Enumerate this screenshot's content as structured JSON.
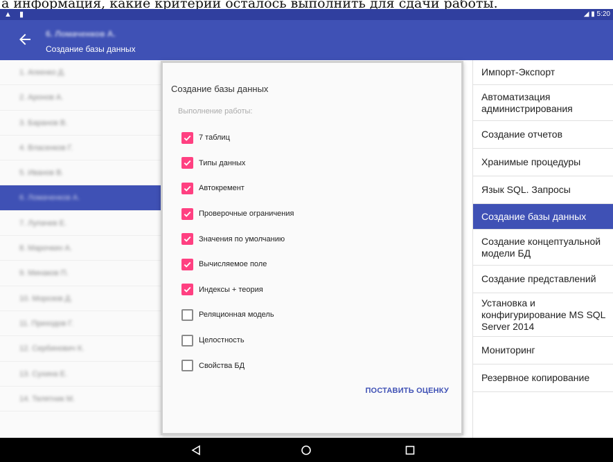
{
  "caption": "а информация, какие критерии осталось выполнить для сдачи работы.",
  "status_bar": {
    "time": "5:20"
  },
  "app_bar": {
    "student": "6. Ломаченков А.",
    "subtitle": "Создание базы данных"
  },
  "students": [
    {
      "label": "1. Агеенко Д.",
      "active": false
    },
    {
      "label": "2. Аронов А.",
      "active": false
    },
    {
      "label": "3. Баранов В.",
      "active": false
    },
    {
      "label": "4. Власенков Г.",
      "active": false
    },
    {
      "label": "5. Иванов В.",
      "active": false
    },
    {
      "label": "6. Ломаченков А.",
      "active": true
    },
    {
      "label": "7. Лупачев Е.",
      "active": false
    },
    {
      "label": "8. Марочкин А.",
      "active": false
    },
    {
      "label": "9. Минаков П.",
      "active": false
    },
    {
      "label": "10. Морозов Д.",
      "active": false
    },
    {
      "label": "11. Приходов Г.",
      "active": false
    },
    {
      "label": "12. Сербинович К.",
      "active": false
    },
    {
      "label": "13. Сухина Е.",
      "active": false
    },
    {
      "label": "14. Телятник М.",
      "active": false
    }
  ],
  "dialog": {
    "title": "Создание базы данных",
    "section": "Выполнение работы:",
    "criteria": [
      {
        "label": "7 таблиц",
        "checked": true
      },
      {
        "label": "Типы данных",
        "checked": true
      },
      {
        "label": "Автокремент",
        "checked": true
      },
      {
        "label": "Проверочные ограничения",
        "checked": true
      },
      {
        "label": "Значения по умолчанию",
        "checked": true
      },
      {
        "label": "Вычисляемое поле",
        "checked": true
      },
      {
        "label": "Индексы + теория",
        "checked": true
      },
      {
        "label": "Реляционная модель",
        "checked": false
      },
      {
        "label": "Целостность",
        "checked": false
      },
      {
        "label": "Свойства БД",
        "checked": false
      }
    ],
    "button": "ПОСТАВИТЬ ОЦЕНКУ"
  },
  "topics": [
    {
      "label": "Импорт-Экспорт",
      "active": false
    },
    {
      "label": "Автоматизация администрирования",
      "active": false
    },
    {
      "label": "Создание отчетов",
      "active": false
    },
    {
      "label": "Хранимые процедуры",
      "active": false
    },
    {
      "label": "Язык SQL. Запросы",
      "active": false
    },
    {
      "label": "Создание базы данных",
      "active": true
    },
    {
      "label": "Создание концептуальной модели БД",
      "active": false
    },
    {
      "label": "Создание представлений",
      "active": false
    },
    {
      "label": "Установка и конфигурирование MS SQL Server 2014",
      "active": false
    },
    {
      "label": "Мониторинг",
      "active": false
    },
    {
      "label": "Резервное копирование",
      "active": false
    }
  ],
  "colors": {
    "primary": "#3f51b5",
    "primary_dark": "#303f9f",
    "accent": "#ff4081"
  },
  "icons": {
    "back": "arrow-left-icon",
    "nav_back": "triangle-back-icon",
    "nav_home": "circle-home-icon",
    "nav_recents": "square-recents-icon"
  }
}
